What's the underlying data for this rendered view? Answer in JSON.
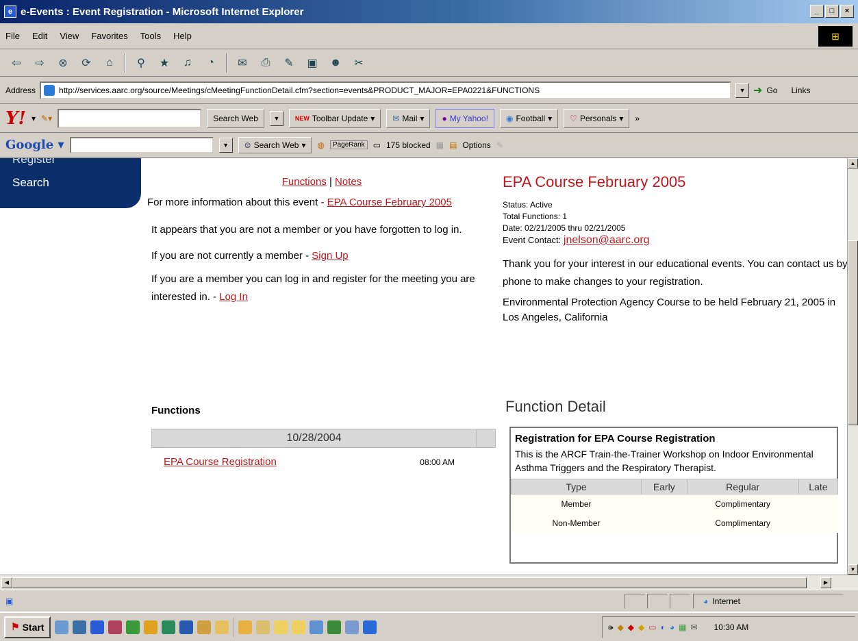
{
  "window": {
    "title": "e-Events : Event Registration - Microsoft Internet Explorer"
  },
  "menu": [
    "File",
    "Edit",
    "View",
    "Favorites",
    "Tools",
    "Help"
  ],
  "address": {
    "label": "Address",
    "url": "http://services.aarc.org/source/Meetings/cMeetingFunctionDetail.cfm?section=events&PRODUCT_MAJOR=EPA0221&FUNCTIONS",
    "go": "Go",
    "links": "Links"
  },
  "yahoo": {
    "search_web": "Search Web",
    "toolbar_update": "Toolbar Update",
    "mail": "Mail",
    "my_yahoo": "My Yahoo!",
    "football": "Football",
    "personals": "Personals"
  },
  "google": {
    "search_web": "Search Web",
    "pagerank": "PageRank",
    "blocked": "175 blocked",
    "options": "Options"
  },
  "nav": {
    "register": "Register",
    "search": "Search"
  },
  "mid": {
    "functions_link": "Functions",
    "sep": "|",
    "notes_link": "Notes",
    "more_info": "For more information about this event -",
    "event_link": "EPA Course February 2005",
    "not_member": "It appears that you are not a member or you have forgotten to log in.",
    "signup_text": "If you are not currently a member -",
    "signup_link": "Sign Up",
    "login_text": "If you are a member you can log in and register for the meeting you are interested in. -",
    "login_link": "Log In",
    "functions_heading": "Functions",
    "date": "10/28/2004",
    "function_link": "EPA Course Registration",
    "function_time": "08:00 AM"
  },
  "right": {
    "event_title": "EPA Course February 2005",
    "status": "Status: Active",
    "total_functions": "Total Functions: 1",
    "date": "Date: 02/21/2005 thru 02/21/2005",
    "contact_label": "Event Contact:",
    "contact_email": "jnelson@aarc.org",
    "thanks": "Thank you for your interest in our educational events. You can contact us by phone to make changes to your registration.",
    "description": "Environmental Protection Agency Course to be held February 21, 2005 in Los Angeles, California",
    "detail_heading": "Function Detail",
    "detail_title": "Registration for EPA Course Registration",
    "detail_desc": "This is the ARCF Train-the-Trainer Workshop on Indoor Environmental Asthma Triggers and the Respiratory Therapist.",
    "price_headers": [
      "Type",
      "Early",
      "Regular",
      "Late"
    ],
    "price_rows": [
      {
        "type": "Member",
        "early": "",
        "regular": "Complimentary",
        "late": ""
      },
      {
        "type": "Non-Member",
        "early": "",
        "regular": "Complimentary",
        "late": ""
      }
    ]
  },
  "status": {
    "zone": "Internet"
  },
  "taskbar": {
    "start": "Start",
    "clock": "10:30 AM"
  }
}
